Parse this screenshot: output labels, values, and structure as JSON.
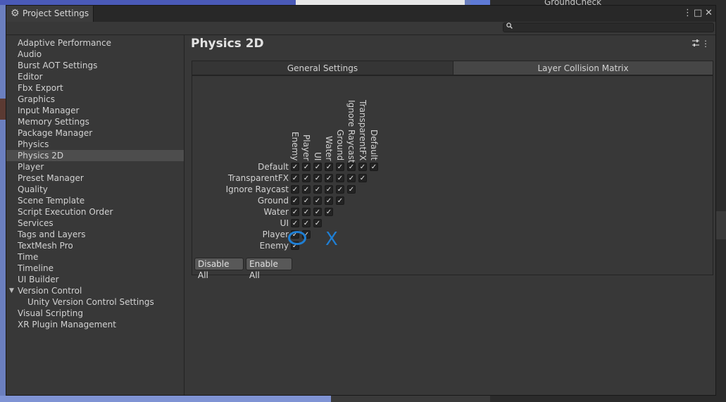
{
  "window": {
    "title": "Project Settings"
  },
  "background": {
    "hierarchy_item": "GroundCheck"
  },
  "search": {
    "value": "",
    "placeholder": ""
  },
  "sidebar": {
    "items": [
      {
        "label": "Adaptive Performance"
      },
      {
        "label": "Audio"
      },
      {
        "label": "Burst AOT Settings"
      },
      {
        "label": "Editor"
      },
      {
        "label": "Fbx Export"
      },
      {
        "label": "Graphics"
      },
      {
        "label": "Input Manager"
      },
      {
        "label": "Memory Settings"
      },
      {
        "label": "Package Manager"
      },
      {
        "label": "Physics"
      },
      {
        "label": "Physics 2D",
        "selected": true
      },
      {
        "label": "Player"
      },
      {
        "label": "Preset Manager"
      },
      {
        "label": "Quality"
      },
      {
        "label": "Scene Template"
      },
      {
        "label": "Script Execution Order"
      },
      {
        "label": "Services"
      },
      {
        "label": "Tags and Layers"
      },
      {
        "label": "TextMesh Pro"
      },
      {
        "label": "Time"
      },
      {
        "label": "Timeline"
      },
      {
        "label": "UI Builder"
      },
      {
        "label": "Version Control",
        "expanded": true
      },
      {
        "label": "Unity Version Control Settings",
        "child": true
      },
      {
        "label": "Visual Scripting"
      },
      {
        "label": "XR Plugin Management"
      }
    ]
  },
  "main": {
    "title": "Physics 2D",
    "tabs": [
      {
        "label": "General Settings",
        "active": false
      },
      {
        "label": "Layer Collision Matrix",
        "active": true
      }
    ]
  },
  "matrix": {
    "columns": [
      "Enemy",
      "Player",
      "UI",
      "Water",
      "Ground",
      "Ignore Raycast",
      "TransparentFX",
      "Default"
    ],
    "rows": [
      "Default",
      "TransparentFX",
      "Ignore Raycast",
      "Ground",
      "Water",
      "UI",
      "Player",
      "Enemy"
    ],
    "checked": [
      [
        true,
        true,
        true,
        true,
        true,
        true,
        true,
        true
      ],
      [
        true,
        true,
        true,
        true,
        true,
        true,
        true
      ],
      [
        true,
        true,
        true,
        true,
        true,
        true
      ],
      [
        true,
        true,
        true,
        true,
        true
      ],
      [
        true,
        true,
        true,
        true
      ],
      [
        true,
        true,
        true
      ],
      [
        true,
        true
      ],
      [
        true
      ]
    ],
    "check_glyph": "✓",
    "buttons": {
      "disable_all": "Disable All",
      "enable_all": "Enable All"
    }
  },
  "annotations": {
    "x_mark": "X",
    "color": "#1f7fd4"
  },
  "icons": {
    "gear": "⚙",
    "more": "⋮",
    "maximize": "□",
    "close": "✕",
    "search": "🔍",
    "presets": "⇶",
    "fold": "▼"
  }
}
